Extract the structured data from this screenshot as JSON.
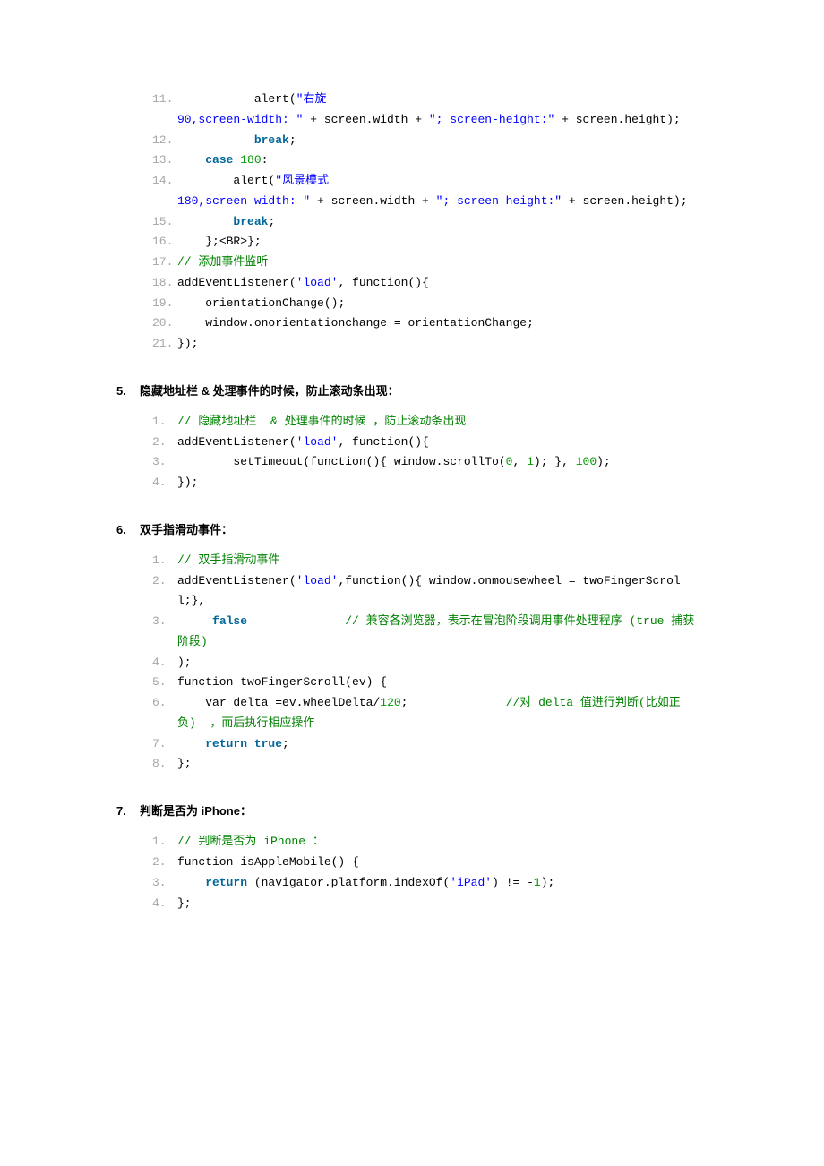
{
  "block1": {
    "lines": {
      "l11_p": "           alert(",
      "l11_s": "\"右旋",
      "l11_cont_s": "90,screen-width: \"",
      "l11_cont_1": " + screen.width + ",
      "l11_cont_s2": "\"; screen-height:\"",
      "l11_cont_2": " + screen.height);",
      "l12_p": "           ",
      "l12_k": "break",
      "l12_t": ";",
      "l13_p": "    ",
      "l13_k": "case",
      "l13_sp": " ",
      "l13_n": "180",
      "l13_t": ":",
      "l14_p": "        alert(",
      "l14_s": "\"风景模式",
      "l14_cont_s": "180,screen-width: \"",
      "l14_cont_1": " + screen.width + ",
      "l14_cont_s2": "\"; screen-height:\"",
      "l14_cont_2": " + screen.height);",
      "l15_p": "        ",
      "l15_k": "break",
      "l15_t": ";",
      "l16": "    };<BR>};",
      "l17": "// 添加事件监听",
      "l18_a": "addEventListener(",
      "l18_s": "'load'",
      "l18_b": ", function(){",
      "l19": "    orientationChange();",
      "l20": "    window.onorientationchange = orientationChange;",
      "l21": "});"
    }
  },
  "section5": {
    "heading": "隐藏地址栏 & 处理事件的时候，防止滚动条出现：",
    "lines": {
      "l1": "// 隐藏地址栏  & 处理事件的时候 ，防止滚动条出现",
      "l2_a": "addEventListener(",
      "l2_s": "'load'",
      "l2_b": ", function(){",
      "l3_a": "        setTimeout(function(){ window.scrollTo(",
      "l3_n1": "0",
      "l3_m": ", ",
      "l3_n2": "1",
      "l3_b": "); }, ",
      "l3_n3": "100",
      "l3_c": ");",
      "l4": "});"
    }
  },
  "section6": {
    "heading": "双手指滑动事件：",
    "lines": {
      "l1": "// 双手指滑动事件",
      "l2_a": "addEventListener(",
      "l2_s": "'load'",
      "l2_b": ",function(){ window.onmousewheel = twoFingerScroll;},",
      "l3_p": "     ",
      "l3_k": "false",
      "l3_sp": "              ",
      "l3_c": "// 兼容各浏览器，表示在冒泡阶段调用事件处理程序 (true 捕获阶段)",
      "l4": ");",
      "l5": "function twoFingerScroll(ev) {",
      "l6_a": "    var delta =ev.wheelDelta/",
      "l6_n": "120",
      "l6_b": ";              ",
      "l6_c": "//对 delta 值进行判断(比如正负)  ，而后执行相应操作",
      "l7_p": "    ",
      "l7_k": "return true",
      "l7_t": ";",
      "l8": "};"
    }
  },
  "section7": {
    "heading": "判断是否为 iPhone：",
    "lines": {
      "l1": "// 判断是否为 iPhone ：",
      "l2": "function isAppleMobile() {",
      "l3_p": "    ",
      "l3_k": "return",
      "l3_a": " (navigator.platform.indexOf(",
      "l3_s": "'iPad'",
      "l3_b": ") != -",
      "l3_n": "1",
      "l3_c": ");",
      "l4": "};"
    }
  },
  "ln": {
    "n1": "1.",
    "n2": "2.",
    "n3": "3.",
    "n4": "4.",
    "n5": "5.",
    "n6": "6.",
    "n7": "7.",
    "n8": "8.",
    "n11": "11.",
    "n12": "12.",
    "n13": "13.",
    "n14": "14.",
    "n15": "15.",
    "n16": "16.",
    "n17": "17.",
    "n18": "18.",
    "n19": "19.",
    "n20": "20.",
    "n21": "21."
  },
  "secnum": {
    "s5": "5.",
    "s6": "6.",
    "s7": "7."
  }
}
